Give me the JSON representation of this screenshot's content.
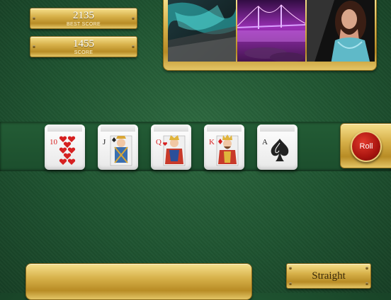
{
  "scores": {
    "best_score_value": "2135",
    "best_score_label": "BEST SCORE",
    "score_value": "1455",
    "score_label": "SCORE"
  },
  "gallery": {
    "images": [
      "teal-abstract-image",
      "purple-bridge-image",
      "woman-portrait-image"
    ]
  },
  "dice": [
    {
      "rank": "10",
      "suit": "hearts",
      "color": "#d62020"
    },
    {
      "rank": "J",
      "suit": "spades",
      "color": "#222222"
    },
    {
      "rank": "Q",
      "suit": "hearts",
      "color": "#d62020"
    },
    {
      "rank": "K",
      "suit": "diamonds",
      "color": "#d62020"
    },
    {
      "rank": "A",
      "suit": "spades",
      "color": "#222222"
    }
  ],
  "roll_button_label": "Roll",
  "combination_label": "Straight",
  "colors": {
    "felt": "#1f5431",
    "gold": "#d7b14a",
    "roll_red": "#a8140f"
  }
}
